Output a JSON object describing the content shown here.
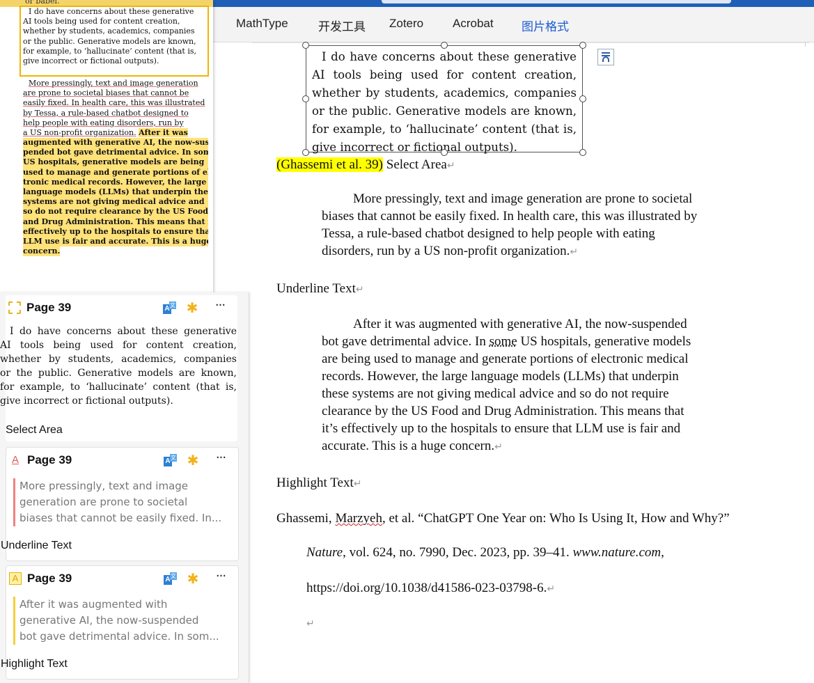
{
  "ribbon": {
    "tabs": [
      "MathType",
      "开发工具",
      "Zotero",
      "Acrobat",
      "图片格式"
    ],
    "active_tab": "图片格式",
    "partial_char": "图"
  },
  "document": {
    "image_lines": [
      "I do have concerns about these generative",
      "AI tools being used for content creation,",
      "whether by students, academics, companies",
      "or the public. Generative models are known,",
      "for example, to ‘hallucinate’ content (that is,",
      "give incorrect or fictional outputs)."
    ],
    "citation": "(Ghassemi et al. 39)",
    "select_area_label": "Select Area",
    "quote1_lines": [
      "More pressingly, text and image generation are prone to societal",
      "biases that cannot be easily fixed. In health care, this was illustrated by",
      "Tessa, a rule-based chatbot designed to help people with eating",
      "disorders, run by a US non-profit organization."
    ],
    "underline_label": "Underline Text",
    "quote2": {
      "l1": "After it was augmented with generative AI, the now-suspended",
      "l2a": "bot gave detrimental advice. In ",
      "l2b": "some",
      "l2c": " US hospitals, generative models",
      "rest": [
        "are being used to manage and generate portions of electronic medical",
        "records. However, the large language models (LLMs) that underpin",
        "these systems are not giving medical advice and so do not require",
        "clearance by the US Food and Drug Administration. This means that",
        "it’s effectively up to the hospitals to ensure that LLM use is fair and",
        "accurate. This is a huge concern."
      ]
    },
    "highlight_label": "Highlight Text",
    "reference": {
      "l1a": "Ghassemi, ",
      "l1b": "Marzyeh",
      "l1c": ", et al. “ChatGPT One Year on: Who Is Using It, How and Why?”",
      "journal": "Nature",
      "l2a": ", vol. 624, no. 7990, Dec. 2023, pp. 39–41. ",
      "site": "www.nature.com",
      "l2b": ",",
      "doi": "https://doi.org/10.1038/d41586-023-03798-6."
    },
    "para_mark": "↵"
  },
  "pdf_excerpt": {
    "top_fragment": "or babel.",
    "box_lines": [
      "I do have concerns about these generative",
      "AI tools being used for content creation,",
      "whether by students, academics, companies",
      "or the public. Generative models are known,",
      "for example, to ‘hallucinate’ content (that is,",
      "give incorrect or fictional outputs)."
    ],
    "underlined_lines": [
      "More pressingly, text and image generation",
      "are prone to societal biases that cannot be",
      "easily fixed. In health care, this was illustrated",
      "by Tessa, a rule-based chatbot designed to",
      "help people with eating disorders, run by",
      "a US non-profit organization."
    ],
    "inline_highlight": "After it was",
    "highlighted_lines": [
      "augmented with generative AI, the now-sus-",
      "pended bot gave detrimental advice. In some",
      "US hospitals, generative models are being",
      "used to manage and generate portions of elec-",
      "tronic medical records. However, the large",
      "language models (LLMs) that underpin these",
      "systems are not giving medical advice and",
      "so do not require clearance by the US Food",
      "and Drug Administration. This means that it’s",
      "effectively up to the hospitals to ensure that",
      "LLM use is fair and accurate. This is a huge",
      "concern."
    ]
  },
  "annotations": [
    {
      "page": "Page 39",
      "type_icon": "select-area-icon",
      "image_lines": [
        "I do have concerns about these generative",
        "AI tools being used for content creation,",
        "whether by students, academics, companies",
        "or the public. Generative models are known,",
        "for example, to ‘hallucinate’ content (that is,",
        "give incorrect or fictional outputs)."
      ],
      "label": "Select Area",
      "accent": "#f5cf3a"
    },
    {
      "page": "Page 39",
      "type_icon": "underline-icon",
      "type_glyph": "A",
      "quote_lines": [
        "More pressingly, text and image",
        "generation are prone to societal",
        "biases that cannot be easily fixed. In..."
      ],
      "label": "Underline Text",
      "accent": "#f08080"
    },
    {
      "page": "Page 39",
      "type_icon": "highlight-icon",
      "type_glyph": "A",
      "quote_lines": [
        "After it was augmented with",
        "generative AI, the now-suspended",
        "bot gave detrimental advice. In som..."
      ],
      "label": "Highlight Text",
      "accent": "#f5cf3a"
    }
  ],
  "card_icons": {
    "translate_a": "A",
    "translate_b": "文",
    "more": "···"
  }
}
